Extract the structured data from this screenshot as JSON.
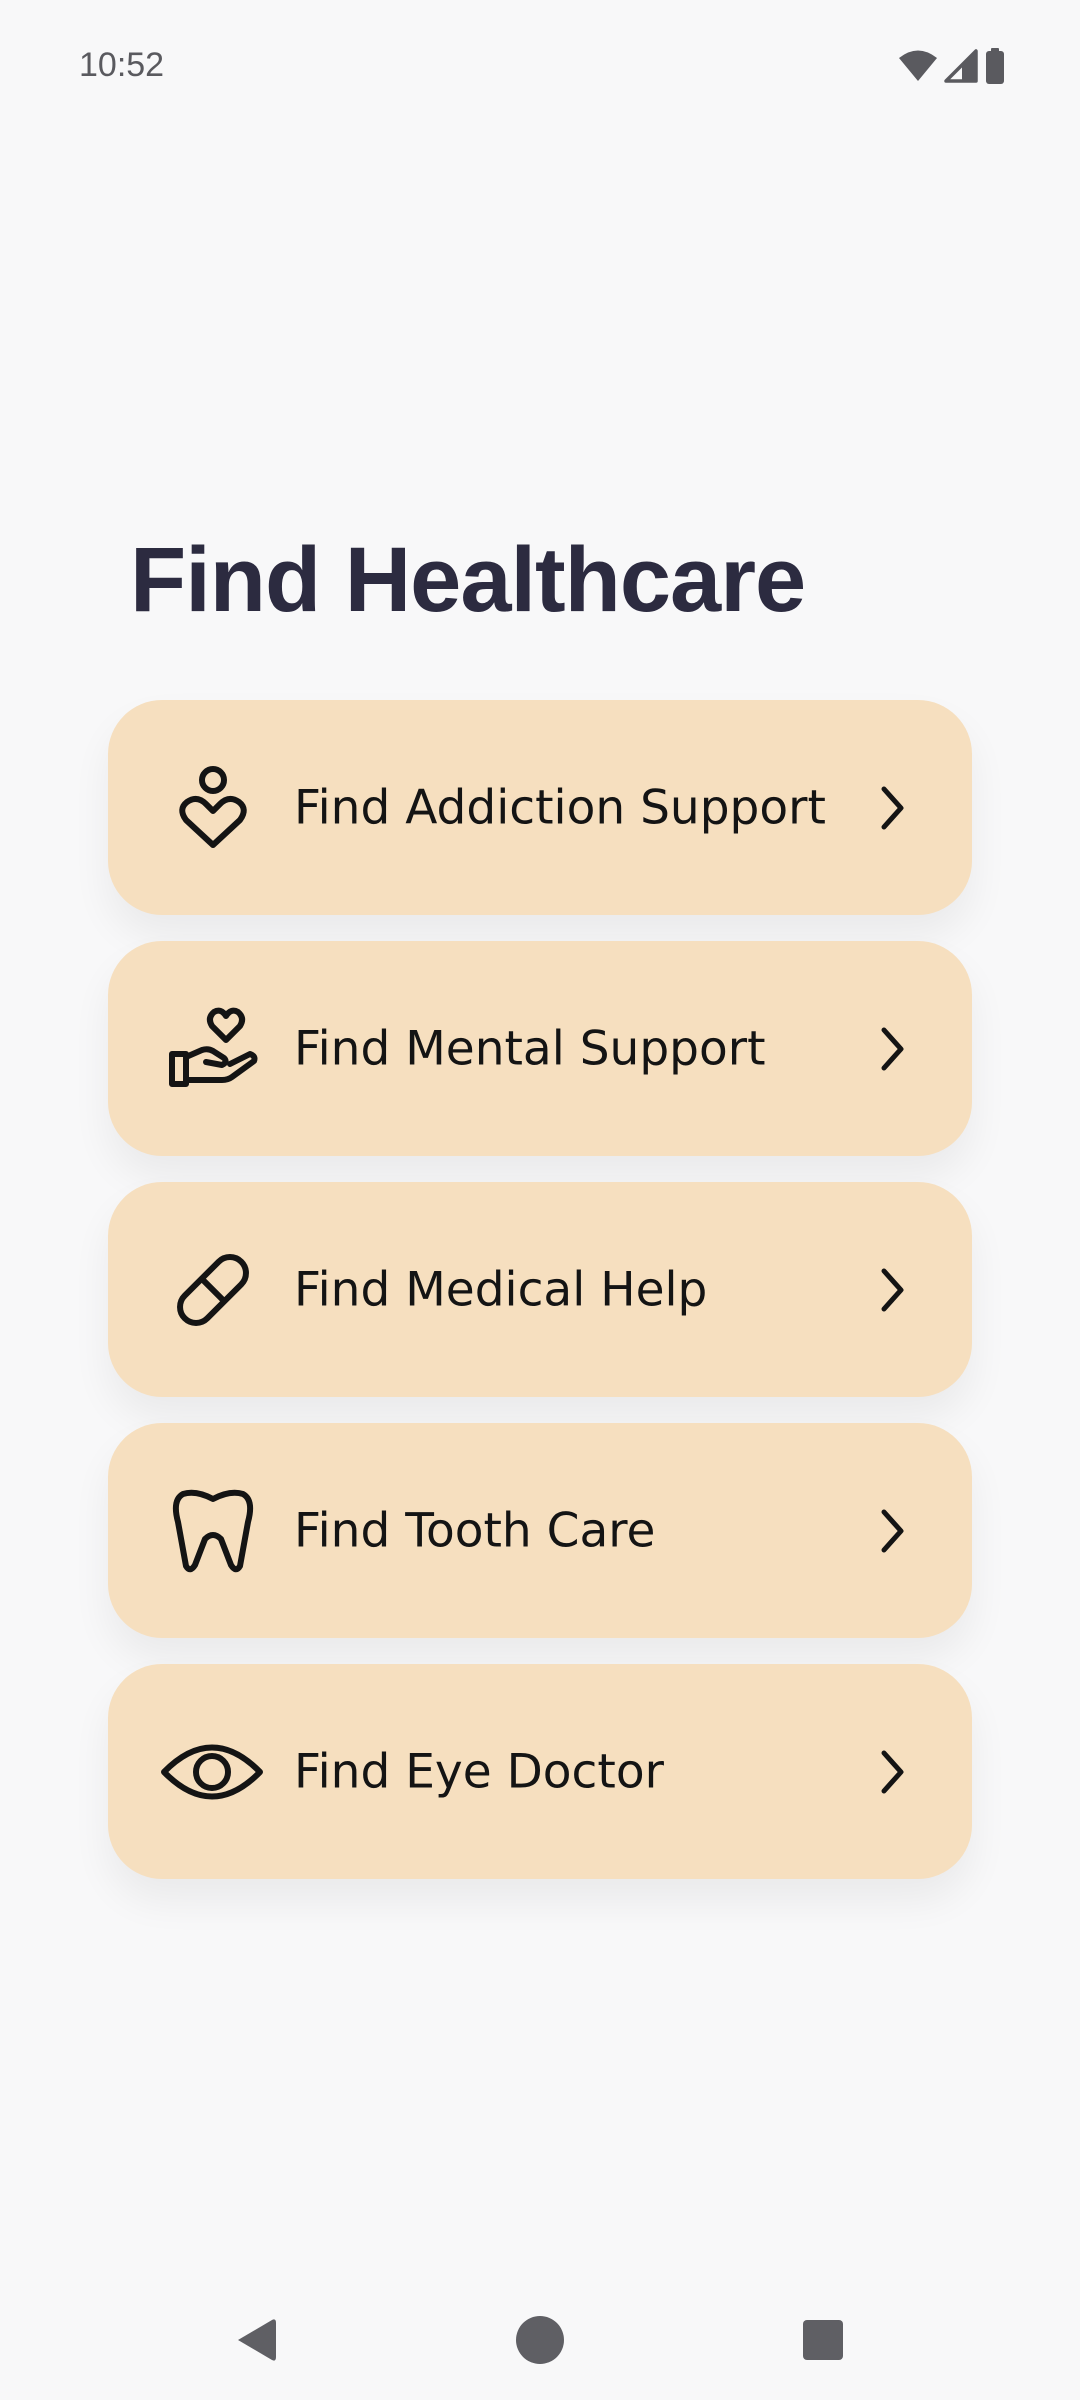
{
  "status_bar": {
    "time": "10:52",
    "icons": [
      "wifi-icon",
      "signal-icon",
      "battery-icon"
    ]
  },
  "page": {
    "title": "Find Healthcare"
  },
  "menu": {
    "items": [
      {
        "label": "Find Addiction Support",
        "icon": "person-heart-icon"
      },
      {
        "label": "Find Mental Support",
        "icon": "hand-heart-icon"
      },
      {
        "label": "Find Medical Help",
        "icon": "pill-icon"
      },
      {
        "label": "Find Tooth Care",
        "icon": "tooth-icon"
      },
      {
        "label": "Find Eye Doctor",
        "icon": "eye-icon"
      }
    ]
  },
  "nav_bar": {
    "buttons": [
      "back-icon",
      "home-icon",
      "recents-icon"
    ]
  },
  "colors": {
    "background": "#f8f8f9",
    "card": "#f6dfbf",
    "title": "#2c2b40",
    "text": "#141414"
  }
}
